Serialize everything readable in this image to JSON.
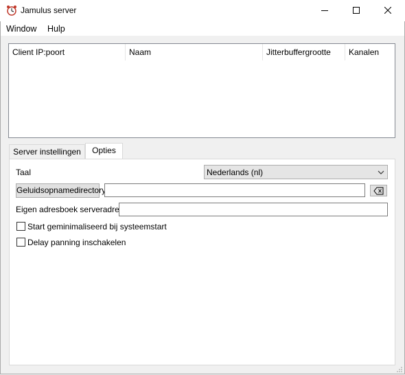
{
  "window": {
    "title": "Jamulus server",
    "controls": {
      "minimize": "minimize-icon",
      "maximize": "maximize-icon",
      "close": "close-icon"
    }
  },
  "menu": {
    "items": [
      "Window",
      "Hulp"
    ]
  },
  "client_table": {
    "columns": [
      "Client IP:poort",
      "Naam",
      "Jitterbuffergrootte",
      "Kanalen"
    ],
    "rows": []
  },
  "tabs": [
    {
      "label": "Server instellingen",
      "active": false
    },
    {
      "label": "Opties",
      "active": true
    }
  ],
  "options": {
    "language_label": "Taal",
    "language_value": "Nederlands (nl)",
    "recording_dir_button": "Geluidsopnamedirectory",
    "recording_dir_value": "",
    "clear_icon": "backspace-icon",
    "directory_address_label": "Eigen adresboek serveradres:",
    "directory_address_value": "",
    "start_minimized_label": "Start geminimaliseerd bij systeemstart",
    "start_minimized_checked": false,
    "delay_panning_label": "Delay panning inschakelen",
    "delay_panning_checked": false
  },
  "colors": {
    "window_bg": "#f0f0f0",
    "panel_bg": "#ffffff",
    "border": "#adadad"
  }
}
